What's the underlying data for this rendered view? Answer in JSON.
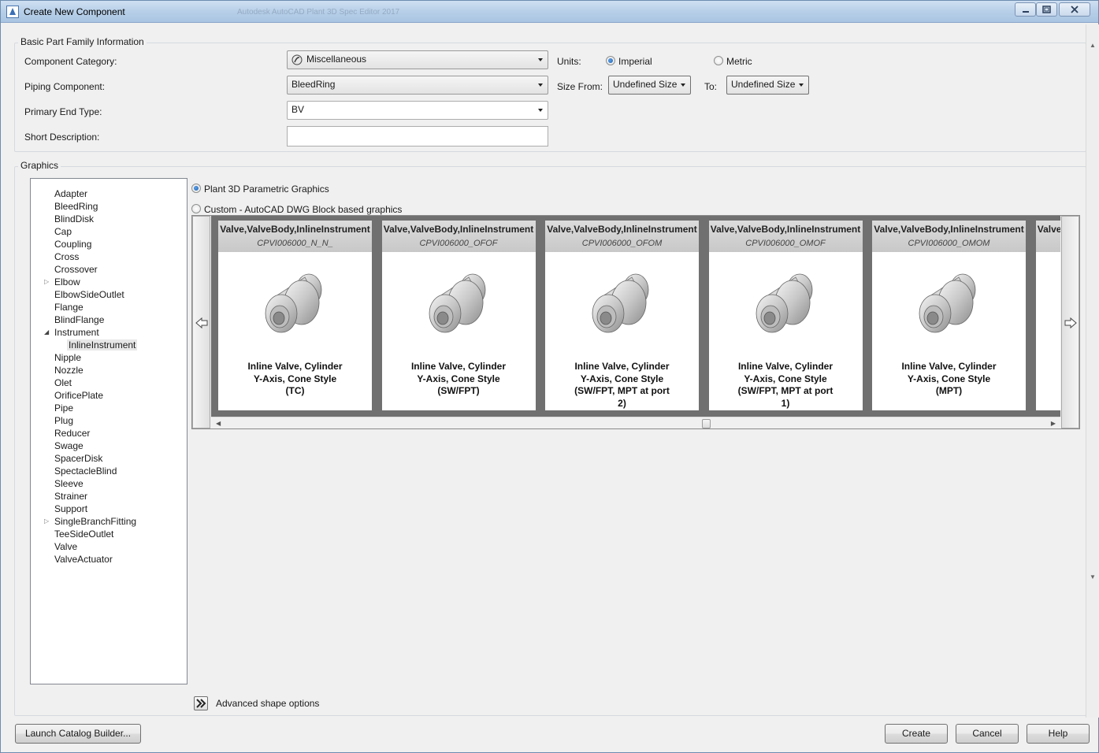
{
  "window": {
    "title": "Create New Component",
    "background_title": "Autodesk AutoCAD Plant 3D Spec Editor 2017",
    "controls": [
      "minimize",
      "maximize",
      "close"
    ]
  },
  "basic_info": {
    "group_label": "Basic Part Family Information",
    "category_label": "Component Category:",
    "category_value": "Miscellaneous",
    "piping_label": "Piping Component:",
    "piping_value": "BleedRing",
    "end_type_label": "Primary End Type:",
    "end_type_value": "BV",
    "short_desc_label": "Short Description:",
    "short_desc_value": "",
    "units_label": "Units:",
    "units_imperial": "Imperial",
    "units_metric": "Metric",
    "units_selected": "Imperial",
    "size_from_label": "Size From:",
    "size_from_value": "Undefined Size",
    "size_to_label": "To:",
    "size_to_value": "Undefined Size"
  },
  "graphics": {
    "group_label": "Graphics",
    "tree": [
      {
        "label": "Adapter"
      },
      {
        "label": "BleedRing"
      },
      {
        "label": "BlindDisk"
      },
      {
        "label": "Cap"
      },
      {
        "label": "Coupling"
      },
      {
        "label": "Cross"
      },
      {
        "label": "Crossover"
      },
      {
        "label": "Elbow",
        "expander": "collapsed"
      },
      {
        "label": "ElbowSideOutlet"
      },
      {
        "label": "Flange"
      },
      {
        "label": "BlindFlange"
      },
      {
        "label": "Instrument",
        "expander": "expanded"
      },
      {
        "label": "InlineInstrument",
        "child": true,
        "selected": true
      },
      {
        "label": "Nipple"
      },
      {
        "label": "Nozzle"
      },
      {
        "label": "Olet"
      },
      {
        "label": "OrificePlate"
      },
      {
        "label": "Pipe"
      },
      {
        "label": "Plug"
      },
      {
        "label": "Reducer"
      },
      {
        "label": "Swage"
      },
      {
        "label": "SpacerDisk"
      },
      {
        "label": "SpectacleBlind"
      },
      {
        "label": "Sleeve"
      },
      {
        "label": "Strainer"
      },
      {
        "label": "Support"
      },
      {
        "label": "SingleBranchFitting",
        "expander": "collapsed"
      },
      {
        "label": "TeeSideOutlet"
      },
      {
        "label": "Valve"
      },
      {
        "label": "ValveActuator"
      }
    ],
    "option_parametric": "Plant 3D Parametric Graphics",
    "option_custom": "Custom - AutoCAD DWG Block based graphics",
    "selected_option": "parametric",
    "cards": [
      {
        "type": "Valve,ValveBody,InlineInstrument",
        "code": "CPVI006000_N_N_",
        "desc": [
          "Inline Valve, Cylinder",
          "Y-Axis, Cone Style",
          "(TC)"
        ]
      },
      {
        "type": "Valve,ValveBody,InlineInstrument",
        "code": "CPVI006000_OFOF",
        "desc": [
          "Inline Valve, Cylinder",
          "Y-Axis, Cone Style",
          "(SW/FPT)"
        ]
      },
      {
        "type": "Valve,ValveBody,InlineInstrument",
        "code": "CPVI006000_OFOM",
        "desc": [
          "Inline Valve, Cylinder",
          "Y-Axis, Cone Style",
          "(SW/FPT, MPT at port",
          "2)"
        ]
      },
      {
        "type": "Valve,ValveBody,InlineInstrument",
        "code": "CPVI006000_OMOF",
        "desc": [
          "Inline Valve, Cylinder",
          "Y-Axis, Cone Style",
          "(SW/FPT, MPT at port",
          "1)"
        ]
      },
      {
        "type": "Valve,ValveBody,InlineInstrument",
        "code": "CPVI006000_OMOM",
        "desc": [
          "Inline Valve, Cylinder",
          "Y-Axis, Cone Style",
          "(MPT)"
        ]
      },
      {
        "type": "Valve,ValveBody,InlineInstrument",
        "code": "",
        "desc": []
      }
    ],
    "advanced_label": "Advanced shape options"
  },
  "footer": {
    "launch_label": "Launch Catalog Builder...",
    "create_label": "Create",
    "cancel_label": "Cancel",
    "help_label": "Help"
  }
}
